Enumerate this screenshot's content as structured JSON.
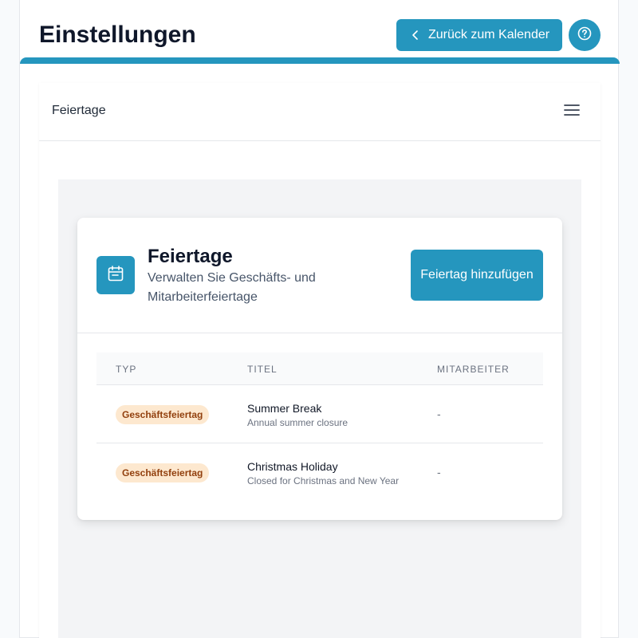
{
  "header": {
    "title": "Einstellungen",
    "back_label": "Zurück zum Kalender",
    "back_icon": "chevron-left-icon",
    "help_icon": "help-circle-icon"
  },
  "tabs": {
    "active_label": "Feiertage",
    "menu_icon": "hamburger-menu-icon"
  },
  "holidays": {
    "title": "Feiertage",
    "subtitle": "Verwalten Sie Geschäfts- und Mitarbeiterfeiertage",
    "add_label": "Feiertag hinzufügen",
    "icon": "calendar-icon",
    "columns": {
      "type": "TYP",
      "title": "TITEL",
      "employee": "MITARBEITER"
    },
    "rows": [
      {
        "type": "Geschäftsfeiertag",
        "title": "Summer Break",
        "description": "Annual summer closure",
        "employee": "-"
      },
      {
        "type": "Geschäftsfeiertag",
        "title": "Christmas Holiday",
        "description": "Closed for Christmas and New Year",
        "employee": "-"
      }
    ]
  },
  "colors": {
    "accent": "#2596be",
    "badge_bg": "#fde8cf",
    "badge_text": "#92400e"
  }
}
